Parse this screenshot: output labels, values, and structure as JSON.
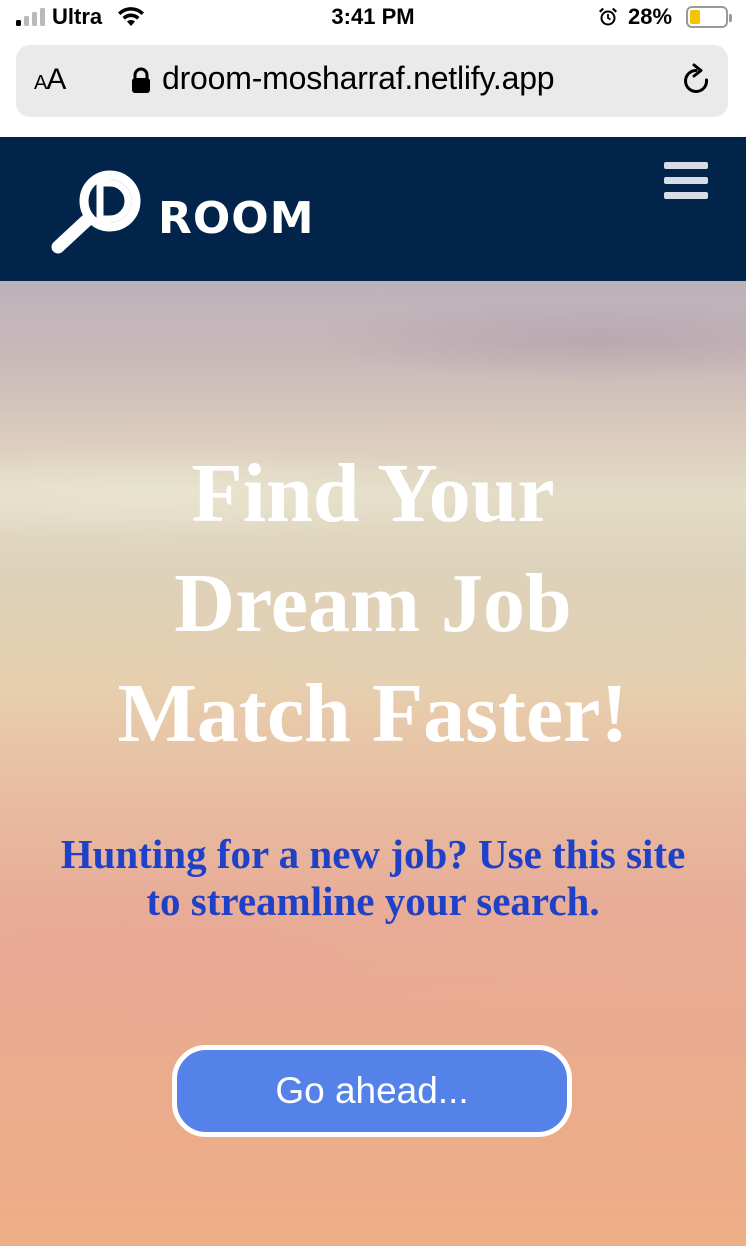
{
  "status_bar": {
    "carrier": "Ultra",
    "time": "3:41 PM",
    "battery_percent": "28%",
    "battery_level": 0.28,
    "signal_bars_active": 1,
    "signal_bars_total": 4,
    "icons": [
      "signal-icon",
      "wifi-icon",
      "alarm-icon",
      "battery-icon"
    ]
  },
  "browser": {
    "text_size_button": {
      "small": "A",
      "large": "A"
    },
    "url": "droom-mosharraf.netlify.app",
    "icons": [
      "lock-icon",
      "reload-icon"
    ]
  },
  "navbar": {
    "logo_text": "ROOM",
    "logo_icon": "magnifier-d-icon",
    "menu_icon": "hamburger-menu-icon",
    "background_color": "#03244a"
  },
  "hero": {
    "title_lines": [
      "Find Your",
      "Dream Job",
      "Match Faster!"
    ],
    "subtitle_lines": [
      "Hunting for a new job? Use this site",
      "to streamline your search."
    ],
    "cta_label": "Go ahead...",
    "title_color": "#ffffff",
    "subtitle_color": "#1f41c8",
    "cta_color": "#5582e8"
  }
}
